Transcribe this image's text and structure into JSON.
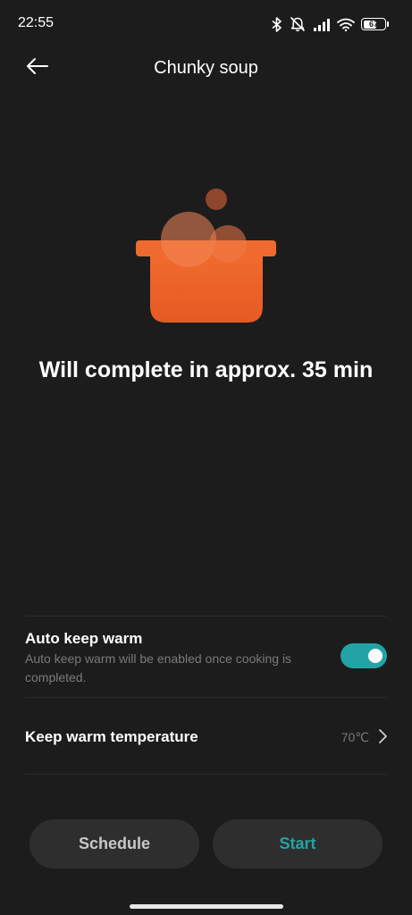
{
  "status_bar": {
    "time": "22:55",
    "battery": "67",
    "battery_level": 0.67,
    "icons": [
      "bluetooth-icon",
      "mute-icon",
      "signal-icon",
      "wifi-icon",
      "battery-icon"
    ]
  },
  "header": {
    "title": "Chunky soup",
    "back_icon": "back-arrow-icon"
  },
  "hero": {
    "icon": "cooking-pot-icon",
    "accent_color": "#ee6a2f"
  },
  "completion": {
    "text": "Will complete in approx. 35 min"
  },
  "settings": {
    "auto_keep_warm": {
      "title": "Auto keep warm",
      "description": "Auto keep warm will be enabled once cooking is completed.",
      "enabled": true
    },
    "keep_warm_temperature": {
      "title": "Keep warm temperature",
      "value": "70℃"
    }
  },
  "actions": {
    "schedule_label": "Schedule",
    "start_label": "Start"
  },
  "colors": {
    "background": "#1c1c1c",
    "accent": "#22a3a6",
    "button_bg": "#2e2e2e"
  }
}
